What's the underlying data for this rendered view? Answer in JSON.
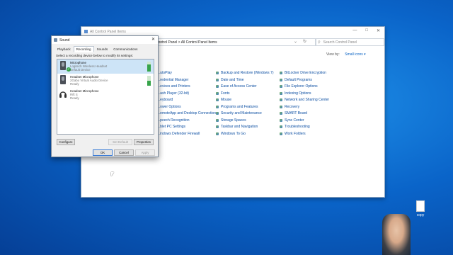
{
  "control_panel": {
    "title": "All Control Panel Items",
    "address": "Control Panel > All Control Panel Items",
    "search_placeholder": "Search Control Panel",
    "view_by_label": "View by:",
    "view_by_value": "Small icons ▾",
    "items_col1": [
      "...utoPlay",
      "...redential Manager",
      "...evices and Printers",
      "...ash Player (32-bit)",
      "...eyboard",
      "...ower Options",
      "...emoteApp and Desktop Connections",
      "...peech Recognition",
      "...blet PC Settings",
      "...indows Defender Firewall"
    ],
    "items_col2": [
      "Backup and Restore (Windows 7)",
      "Date and Time",
      "Ease of Access Center",
      "Fonts",
      "Mouse",
      "Programs and Features",
      "Security and Maintenance",
      "Storage Spaces",
      "Taskbar and Navigation",
      "Windows To Go"
    ],
    "items_col3": [
      "BitLocker Drive Encryption",
      "Default Programs",
      "File Explorer Options",
      "Indexing Options",
      "Network and Sharing Center",
      "Recovery",
      "SMART Board",
      "Sync Center",
      "Troubleshooting",
      "Work Folders"
    ]
  },
  "sound_dialog": {
    "title": "Sound",
    "tabs": [
      "Playback",
      "Recording",
      "Sounds",
      "Communications"
    ],
    "active_tab": "Recording",
    "instruction": "Select a recording device below to modify its settings:",
    "devices": [
      {
        "name": "Microphone",
        "line2": "Logitech Wireless Headset",
        "line3": "Default Device",
        "level": 0.7,
        "selected": true
      },
      {
        "name": "Headset Microphone",
        "line2": "2Gabo Virtual Audio Device",
        "line3": "Ready",
        "level": 0.5,
        "selected": false
      },
      {
        "name": "Headset Microphone",
        "line2": "Rift S",
        "line3": "Ready",
        "level": 0.0,
        "selected": false
      }
    ],
    "buttons": {
      "configure": "Configure",
      "set_default": "Set Default",
      "properties": "Properties",
      "ok": "OK",
      "cancel": "Cancel",
      "apply": "Apply"
    }
  },
  "desktop_file": {
    "label": "copy"
  }
}
